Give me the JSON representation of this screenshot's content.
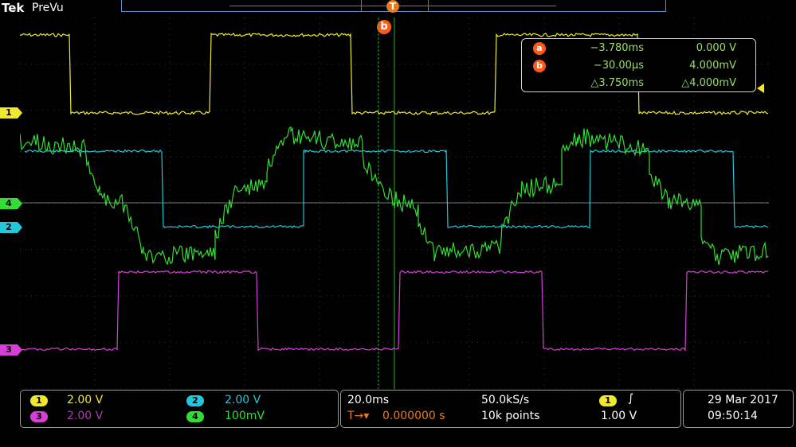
{
  "header": {
    "brand": "Tek",
    "mode": "PreVu",
    "trigger_position_label": "T"
  },
  "cursor_b_label": "b",
  "channels": [
    {
      "id": "1",
      "color": "#f0e830",
      "scale": "2.00 V"
    },
    {
      "id": "2",
      "color": "#22c7d9",
      "scale": "2.00 V"
    },
    {
      "id": "3",
      "color": "#d63fd6",
      "scale": "2.00 V"
    },
    {
      "id": "4",
      "color": "#33dd33",
      "scale": "100mV"
    }
  ],
  "cursor_readout": {
    "a": {
      "label": "a",
      "time": "−3.780ms",
      "volt": "0.000 V"
    },
    "b": {
      "label": "b",
      "time": "−30.00µs",
      "volt": "4.000mV"
    },
    "delta": {
      "time": "△3.750ms",
      "volt": "△4.000mV"
    }
  },
  "timebase": {
    "scale": "20.0ms",
    "trigger_delay": "0.000000 s",
    "delay_icon": "T→▾",
    "sample_rate": "50.0kS/s",
    "record_length": "10k points"
  },
  "trigger": {
    "source": "1",
    "slope_icon": "rising-edge-icon",
    "slope_glyph": "∫",
    "level": "1.00 V"
  },
  "datetime": {
    "date": "29 Mar  2017",
    "time": "09:50:14"
  },
  "colors": {
    "grid": "#3a3a3a",
    "cursor": "#1db31d",
    "orange": "#ff5a1a",
    "frame": "#9a9a9a"
  }
}
